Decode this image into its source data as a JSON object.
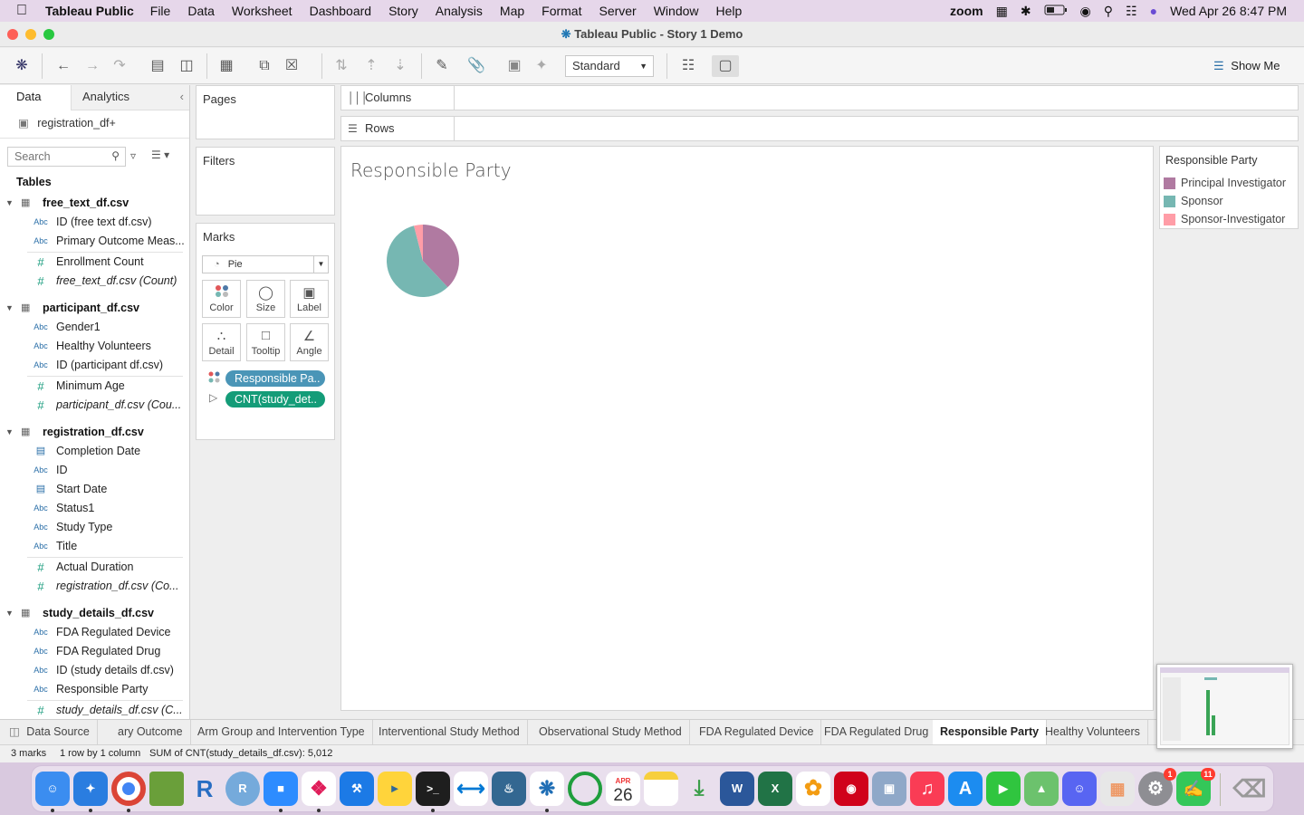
{
  "menubar": {
    "app": "Tableau Public",
    "items": [
      "File",
      "Data",
      "Worksheet",
      "Dashboard",
      "Story",
      "Analysis",
      "Map",
      "Format",
      "Server",
      "Window",
      "Help"
    ],
    "zoom": "zoom",
    "datetime": "Wed Apr 26  8:47 PM"
  },
  "window": {
    "title": "Tableau Public - Story 1 Demo"
  },
  "toolbar": {
    "fit": "Standard",
    "show_me": "Show Me"
  },
  "datapane": {
    "tab_data": "Data",
    "tab_analytics": "Analytics",
    "datasource": "registration_df+",
    "search_placeholder": "Search",
    "tables_label": "Tables",
    "tables": [
      {
        "name": "free_text_df.csv",
        "fields": [
          {
            "type": "Abc",
            "name": "ID (free text df.csv)"
          },
          {
            "type": "Abc",
            "name": "Primary Outcome Meas..."
          },
          {
            "type": "#",
            "name": "Enrollment Count"
          },
          {
            "type": "#",
            "name": "free_text_df.csv (Count)"
          }
        ]
      },
      {
        "name": "participant_df.csv",
        "fields": [
          {
            "type": "Abc",
            "name": "Gender1"
          },
          {
            "type": "Abc",
            "name": "Healthy Volunteers"
          },
          {
            "type": "Abc",
            "name": "ID (participant df.csv)"
          },
          {
            "type": "#",
            "name": "Minimum Age"
          },
          {
            "type": "#",
            "name": "participant_df.csv (Cou..."
          }
        ]
      },
      {
        "name": "registration_df.csv",
        "fields": [
          {
            "type": "date",
            "name": "Completion Date"
          },
          {
            "type": "Abc",
            "name": "ID"
          },
          {
            "type": "date",
            "name": "Start Date"
          },
          {
            "type": "Abc",
            "name": "Status1"
          },
          {
            "type": "Abc",
            "name": "Study Type"
          },
          {
            "type": "Abc",
            "name": "Title"
          },
          {
            "type": "#",
            "name": "Actual Duration"
          },
          {
            "type": "#",
            "name": "registration_df.csv (Co..."
          }
        ]
      },
      {
        "name": "study_details_df.csv",
        "fields": [
          {
            "type": "Abc",
            "name": "FDA Regulated Device"
          },
          {
            "type": "Abc",
            "name": "FDA Regulated Drug"
          },
          {
            "type": "Abc",
            "name": "ID (study details df.csv)"
          },
          {
            "type": "Abc",
            "name": "Responsible Party"
          },
          {
            "type": "#",
            "name": "study_details_df.csv (C..."
          }
        ]
      }
    ]
  },
  "cards": {
    "pages": "Pages",
    "filters": "Filters",
    "marks": "Marks",
    "mark_type": "Pie",
    "mark_buttons": [
      "Color",
      "Size",
      "Label",
      "Detail",
      "Tooltip",
      "Angle"
    ],
    "pill_color": "Responsible Pa..",
    "pill_angle": "CNT(study_det.."
  },
  "shelves": {
    "columns": "Columns",
    "rows": "Rows"
  },
  "viz": {
    "title": "Responsible Party"
  },
  "legend": {
    "title": "Responsible Party",
    "items": [
      {
        "label": "Principal Investigator",
        "color": "#b07aa1"
      },
      {
        "label": "Sponsor",
        "color": "#76b7b2"
      },
      {
        "label": "Sponsor-Investigator",
        "color": "#ff9da7"
      }
    ]
  },
  "chart_data": {
    "type": "pie",
    "categories": [
      "Principal Investigator",
      "Sponsor",
      "Sponsor-Investigator"
    ],
    "values": [
      38,
      58,
      4
    ],
    "colors": [
      "#b07aa1",
      "#76b7b2",
      "#ff9da7"
    ]
  },
  "sheet_tabs": [
    "Data Source",
    "ary Outcome",
    "Arm Group and Intervention Type",
    "Interventional Study Method",
    "Observational Study Method",
    "FDA Regulated Device",
    "FDA Regulated Drug",
    "Responsible Party",
    "Healthy Volunteers"
  ],
  "active_tab": "Responsible Party",
  "status": {
    "marks": "3 marks",
    "dims": "1 row by 1 column",
    "sum": "SUM of CNT(study_details_df.csv): 5,012"
  },
  "dock": {
    "calendar_month": "APR",
    "calendar_day": "26",
    "badge_settings": "1",
    "badge_messages": "11"
  }
}
